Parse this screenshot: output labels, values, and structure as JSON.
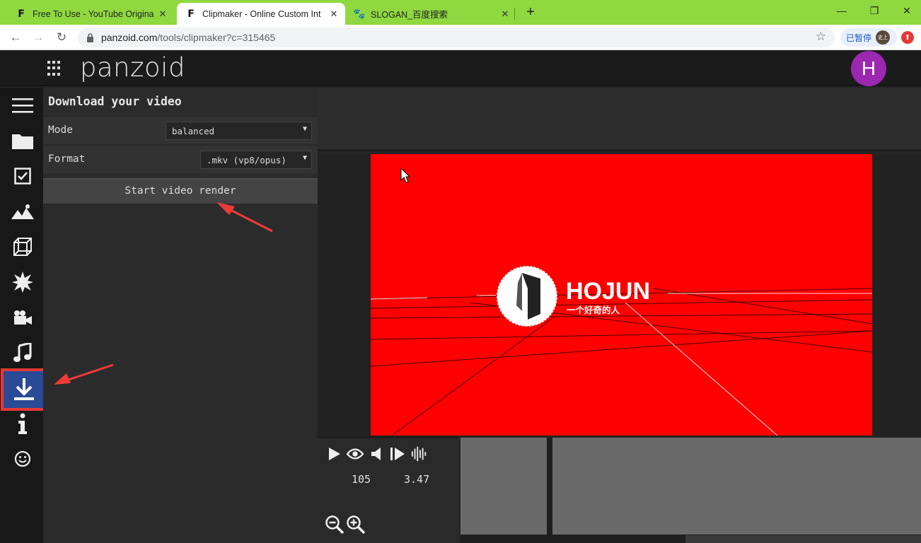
{
  "browser": {
    "tabs": [
      {
        "title": "Free To Use - YouTube Origina",
        "favicon": "panzoid-icon"
      },
      {
        "title": "Clipmaker - Online Custom Int",
        "favicon": "panzoid-icon",
        "active": true
      },
      {
        "title": "SLOGAN_百度搜索",
        "favicon": "baidu-icon"
      }
    ],
    "new_tab_label": "+",
    "url_host": "panzoid.com",
    "url_path": "/tools/clipmaker?c=315465",
    "paused_label": "已暂停",
    "profile_avatar_text": "史上"
  },
  "app": {
    "logo": "panzoid",
    "user_initial": "H"
  },
  "sidebar": {
    "items": [
      "menu-icon",
      "folder-icon",
      "checkbox-icon",
      "image-icon",
      "cube-icon",
      "burst-icon",
      "camera-icon",
      "music-icon",
      "download-icon",
      "info-icon",
      "smiley-icon"
    ],
    "active": "download-icon"
  },
  "panel": {
    "title": "Download your video",
    "mode_label": "Mode",
    "mode_value": "balanced",
    "format_label": "Format",
    "format_value": ".mkv (vp8/opus)",
    "render_button": "Start video render"
  },
  "preview": {
    "background_color": "#ff0000",
    "brand_text": "HOJUN",
    "brand_subtext": "一个好奇的人"
  },
  "timeline": {
    "readout_left": "105",
    "readout_right": "3.47"
  },
  "colors": {
    "tab_bar": "#8fd83f",
    "active_sidebar": "#2b4a96",
    "highlight": "#e53935",
    "avatar": "#9c27b0"
  }
}
